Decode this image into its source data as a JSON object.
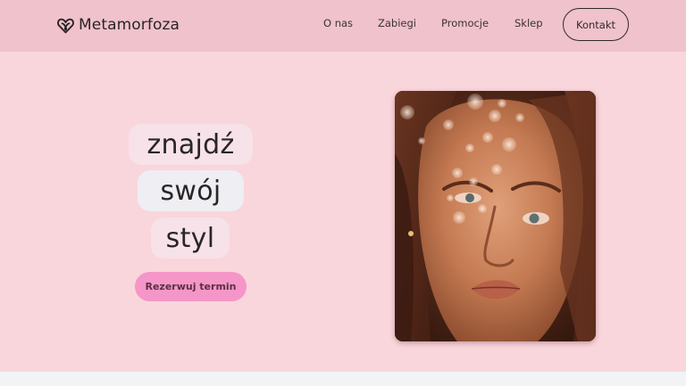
{
  "header": {
    "logo_text": "Metamorfoza",
    "logo_icon": "heart-knot-icon",
    "nav": [
      {
        "label": "O nas"
      },
      {
        "label": "Zabiegi"
      },
      {
        "label": "Promocje"
      },
      {
        "label": "Sklep"
      }
    ],
    "contact_label": "Kontakt"
  },
  "hero": {
    "words": [
      "znajdź",
      "swój",
      "styl"
    ],
    "cta_label": "Rezerwuj termin",
    "image": "portrait-photo"
  },
  "colors": {
    "header_bg": "#f0c2cc",
    "hero_bg": "#f9d6dc",
    "cta_bg": "#f596c8",
    "text": "#2a2526"
  }
}
